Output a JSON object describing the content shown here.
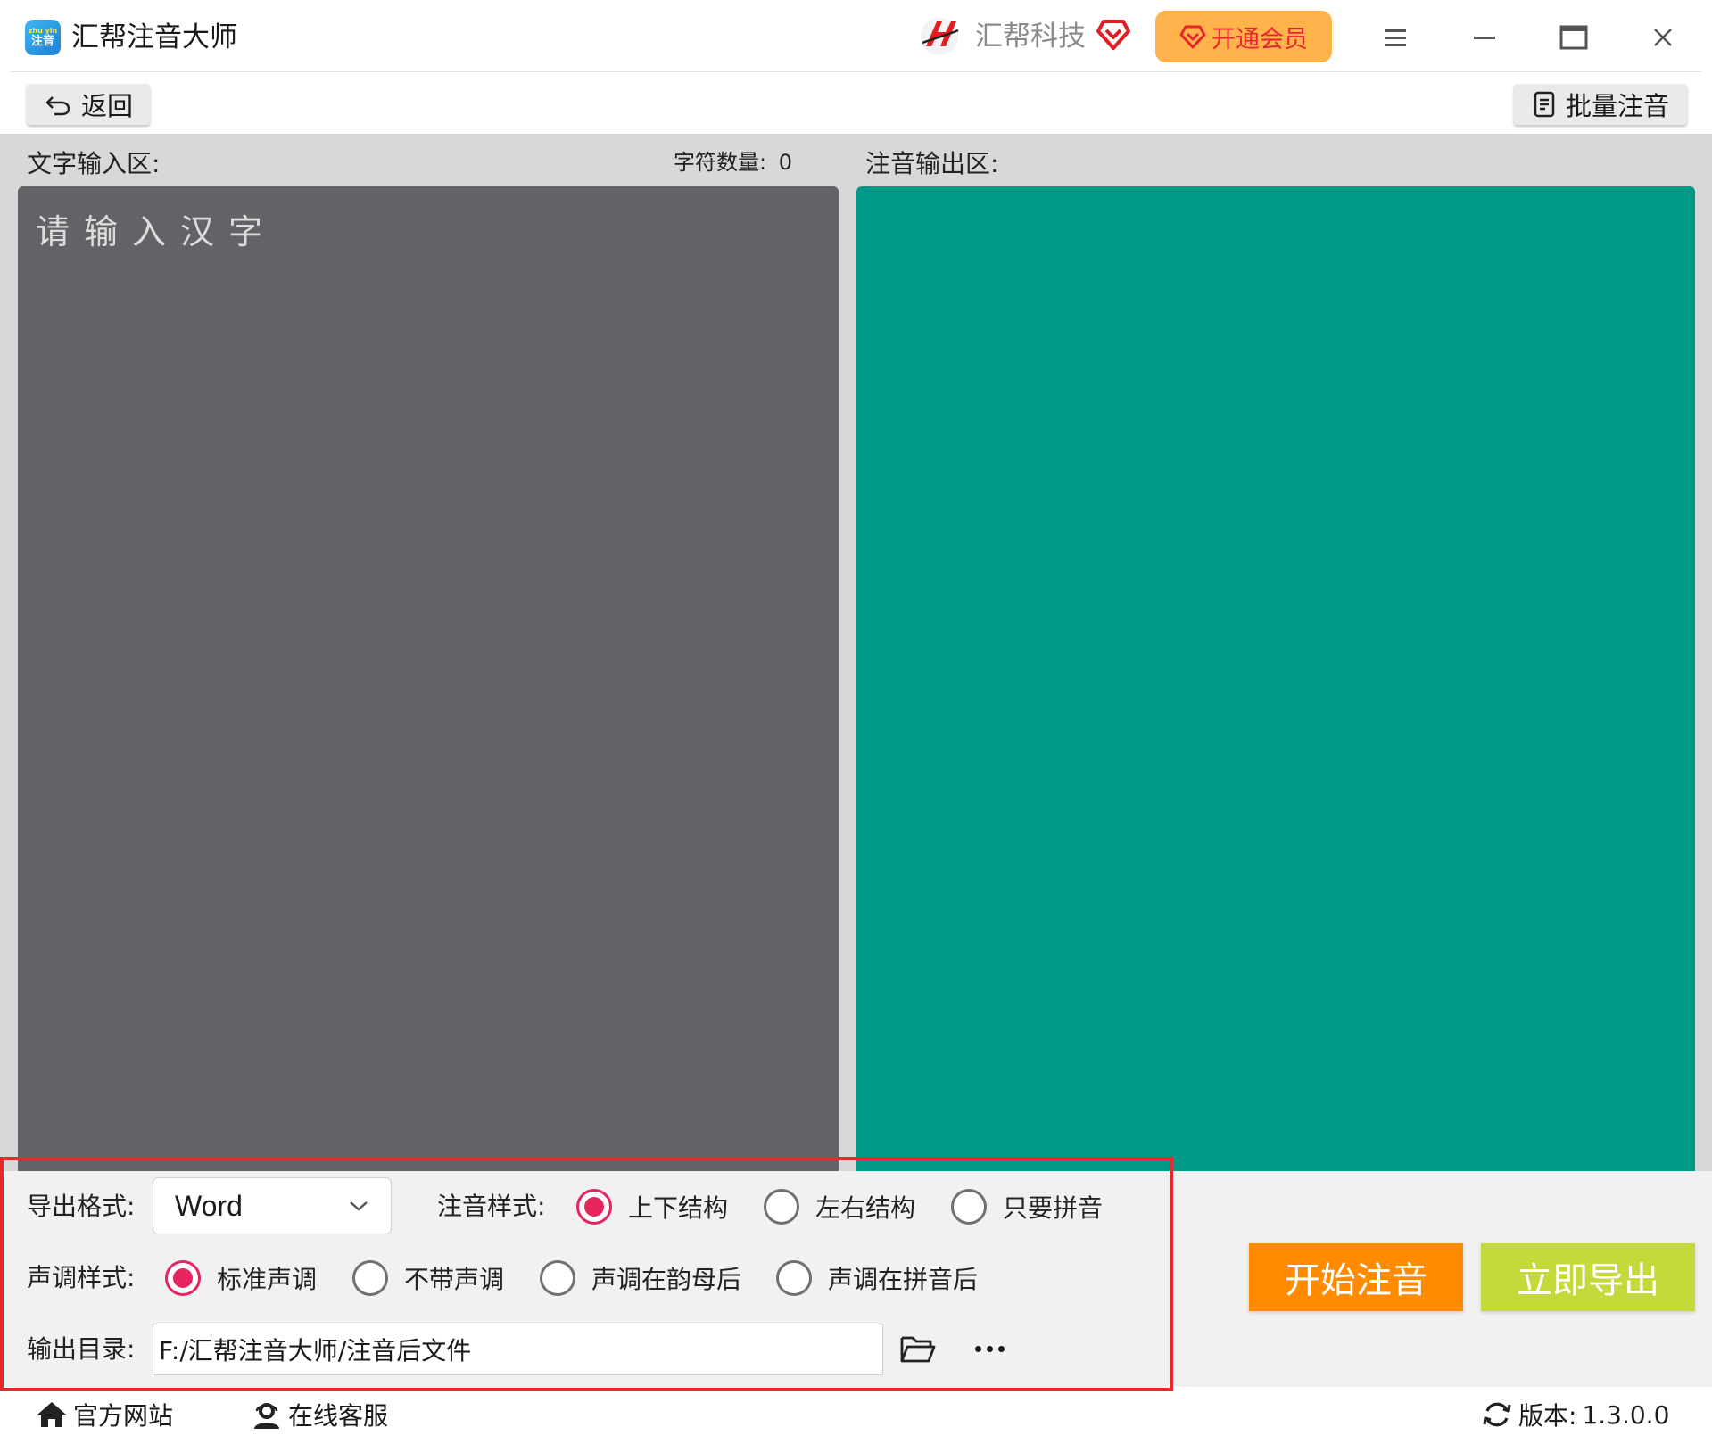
{
  "app": {
    "title": "汇帮注音大师",
    "logo_top": "zhu yin",
    "logo_bottom": "注音"
  },
  "header": {
    "brand_name": "汇帮科技",
    "vip_label": "开通会员"
  },
  "toolbar": {
    "back_label": "返回",
    "batch_label": "批量注音"
  },
  "input": {
    "label": "文字输入区:",
    "char_count_label": "字符数量:",
    "char_count": "0",
    "placeholder": "请输入汉字"
  },
  "output": {
    "label": "注音输出区:"
  },
  "options": {
    "format_label": "导出格式:",
    "format_value": "Word",
    "style_label": "注音样式:",
    "styles": [
      {
        "label": "上下结构",
        "checked": true
      },
      {
        "label": "左右结构",
        "checked": false
      },
      {
        "label": "只要拼音",
        "checked": false
      }
    ],
    "tone_label": "声调样式:",
    "tones": [
      {
        "label": "标准声调",
        "checked": true
      },
      {
        "label": "不带声调",
        "checked": false
      },
      {
        "label": "声调在韵母后",
        "checked": false
      },
      {
        "label": "声调在拼音后",
        "checked": false
      }
    ],
    "dir_label": "输出目录:",
    "dir_value": "F:/汇帮注音大师/注音后文件"
  },
  "actions": {
    "start_label": "开始注音",
    "export_label": "立即导出"
  },
  "status": {
    "site_label": "官方网站",
    "service_label": "在线客服",
    "version_label": "版本:",
    "version_value": "1.3.0.0"
  },
  "colors": {
    "input_bg": "#626366",
    "output_bg": "#009987",
    "accent_radio": "#e8245f",
    "start_btn": "#ff8b00",
    "export_btn": "#c6d93a",
    "vip_btn": "#ffb34a",
    "highlight_frame": "#e8282b"
  },
  "icons": [
    "back-arrow-icon",
    "batch-document-icon",
    "brand-logo-icon",
    "heart-diamond-icon",
    "menu-icon",
    "minimize-icon",
    "maximize-icon",
    "close-icon",
    "chevron-down-icon",
    "folder-open-icon",
    "more-icon",
    "home-icon",
    "customer-service-icon",
    "refresh-icon"
  ]
}
